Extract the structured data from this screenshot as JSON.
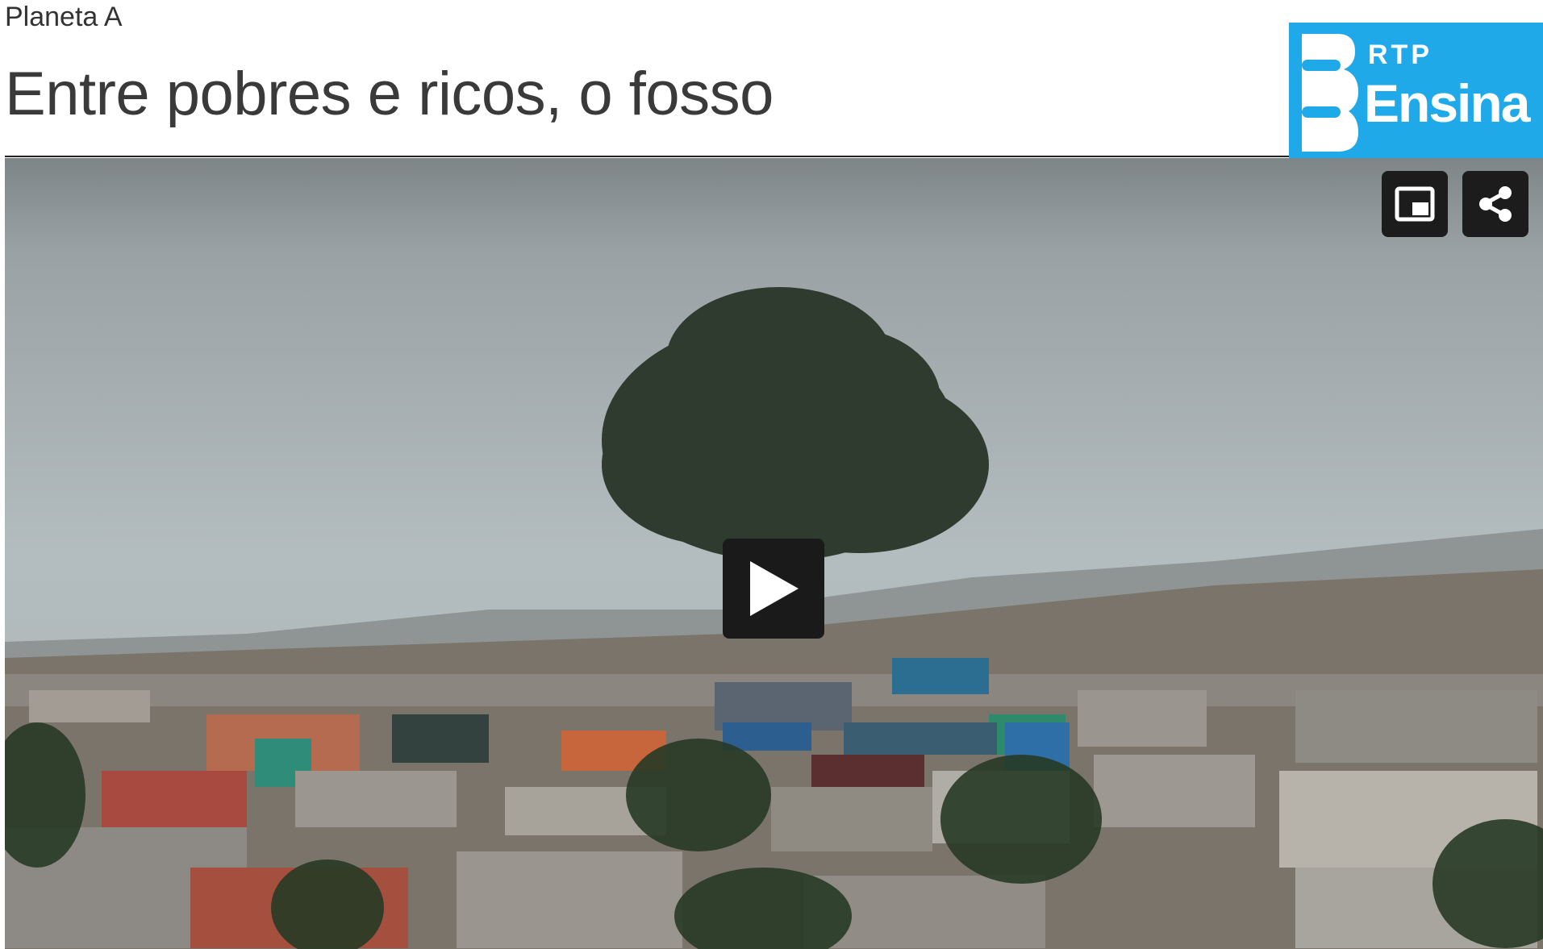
{
  "header": {
    "series": "Planeta A",
    "title": "Entre pobres e ricos, o fosso"
  },
  "logo": {
    "top_text": "RTP",
    "main_text": "Ensina",
    "background_color": "#1fa9e8"
  },
  "video": {
    "controls": {
      "pip_icon": "picture-in-picture-icon",
      "share_icon": "share-icon",
      "play_icon": "play-icon"
    }
  }
}
